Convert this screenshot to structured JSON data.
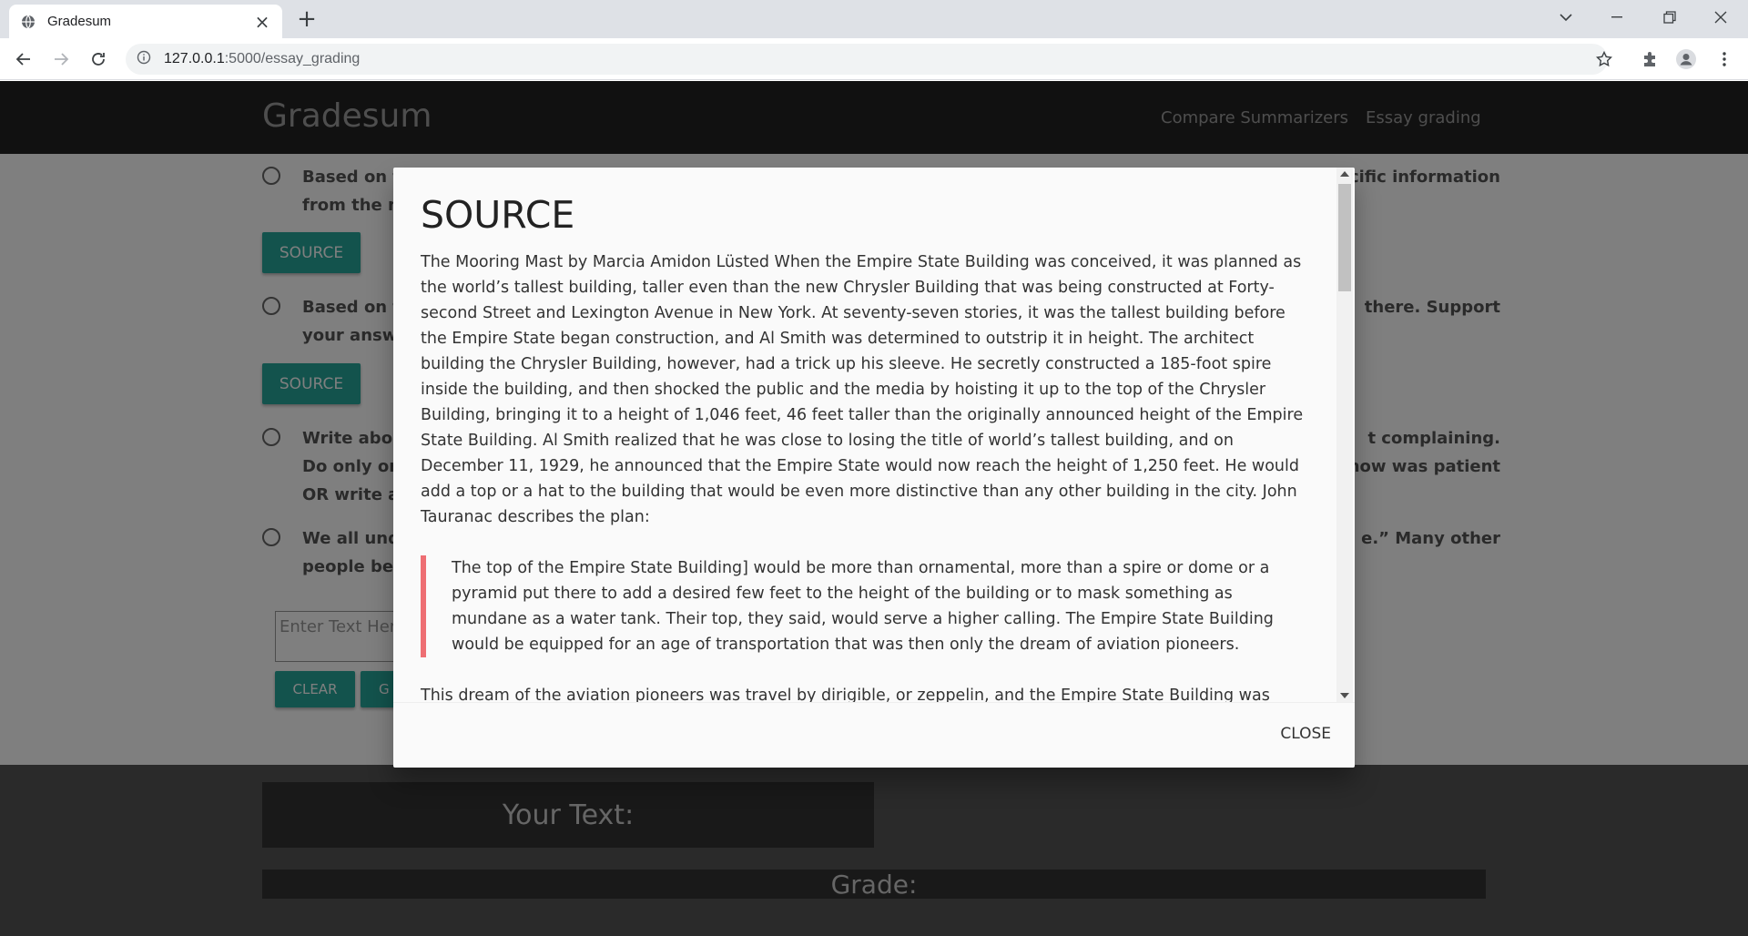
{
  "browser": {
    "tab_title": "Gradesum",
    "url_host": "127.0.0.1",
    "url_path": ":5000/essay_grading"
  },
  "navbar": {
    "brand": "Gradesum",
    "links": [
      "Compare Summarizers",
      "Essay grading"
    ]
  },
  "questions": [
    {
      "line1": "Based on th",
      "line1_end": "cific information",
      "line2": "from the m"
    },
    {
      "line1": "Based on th",
      "line1_end": "there. Support",
      "line2": "your answe"
    },
    {
      "line1": "Write abou",
      "line1_end": "t complaining.",
      "line2": "Do only one",
      "line2_end": "now was patient",
      "line3": "OR write a s"
    },
    {
      "line1": "We all unde",
      "line1_end": "e.” Many other",
      "line2": "people beli"
    }
  ],
  "source_button_label": "SOURCE",
  "essay_input": {
    "placeholder": "Enter Text Here"
  },
  "buttons": {
    "clear": "CLEAR",
    "grade_partial": "G"
  },
  "results": {
    "your_text_label": "Your Text:",
    "grade_label": "Grade:"
  },
  "modal": {
    "title": "SOURCE",
    "paragraph1": "The Mooring Mast by Marcia Amidon Lüsted When the Empire State Building was conceived, it was planned as the world’s tallest building, taller even than the new Chrysler Building that was being constructed at Forty-second Street and Lexington Avenue in New York. At seventy-seven stories, it was the tallest building before the Empire State began construction, and Al Smith was determined to outstrip it in height. The architect building the Chrysler Building, however, had a trick up his sleeve. He secretly constructed a 185-foot spire inside the building, and then shocked the public and the media by hoisting it up to the top of the Chrysler Building, bringing it to a height of 1,046 feet, 46 feet taller than the originally announced height of the Empire State Building. Al Smith realized that he was close to losing the title of world’s tallest building, and on December 11, 1929, he announced that the Empire State would now reach the height of 1,250 feet. He would add a top or a hat to the building that would be even more distinctive than any other building in the city. John Tauranac describes the plan:",
    "quote": "The top of the Empire State Building] would be more than ornamental, more than a spire or dome or a pyramid put there to add a desired few feet to the height of the building or to mask something as mundane as a water tank. Their top, they said, would serve a higher calling. The Empire State Building would be equipped for an age of transportation that was then only the dream of aviation pioneers.",
    "paragraph2": "This dream of the aviation pioneers was travel by dirigible, or zeppelin, and the Empire State Building was going to have a mooring mast at its top for docking these new airships, which would accommodate passengers on already",
    "close_label": "CLOSE"
  }
}
